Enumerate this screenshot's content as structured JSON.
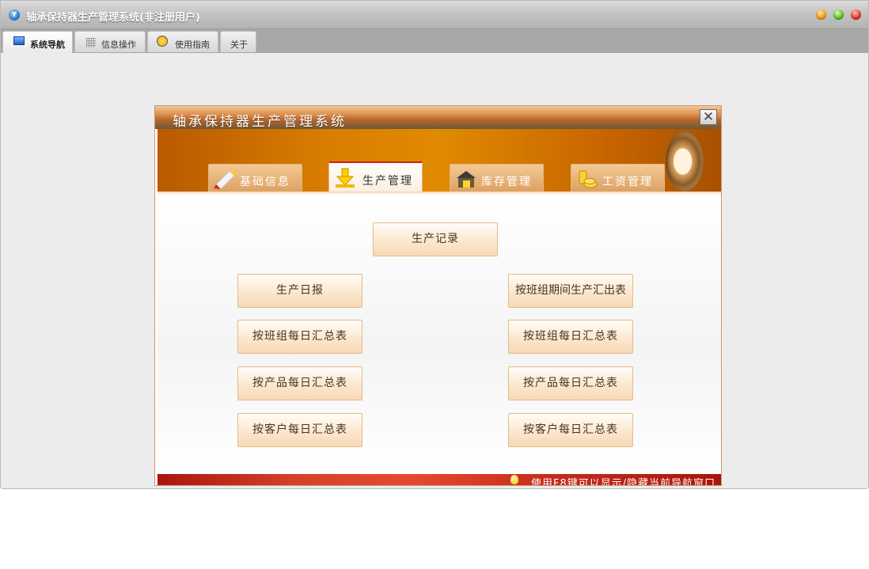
{
  "window": {
    "title": "轴承保持器生产管理系统(非注册用户)",
    "icon_text": "Y"
  },
  "main_tabs": [
    {
      "label": "系统导航",
      "active": true,
      "icon": "monitor-icon"
    },
    {
      "label": "信息操作",
      "active": false,
      "icon": "grid-icon"
    },
    {
      "label": "使用指南",
      "active": false,
      "icon": "guide-icon"
    },
    {
      "label": "关于",
      "active": false
    }
  ],
  "sub_window": {
    "title": "轴承保持器生产管理系统",
    "close_glyph": "✕"
  },
  "nav_tabs": [
    {
      "label": "基础信息",
      "active": false,
      "icon": "pencil-icon"
    },
    {
      "label": "生产管理",
      "active": true,
      "icon": "download-arrow-icon"
    },
    {
      "label": "库存管理",
      "active": false,
      "icon": "warehouse-icon"
    },
    {
      "label": "工资管理",
      "active": false,
      "icon": "coins-icon"
    }
  ],
  "buttons": {
    "production_record": "生产记录",
    "daily_report": "生产日报",
    "team_period_summary": "按班组期间生产汇出表",
    "team_daily_left": "按班组每日汇总表",
    "team_daily_right": "按班组每日汇总表",
    "product_daily_left": "按产品每日汇总表",
    "product_daily_right": "按产品每日汇总表",
    "customer_daily_left": "按客户每日汇总表",
    "customer_daily_right": "按客户每日汇总表"
  },
  "status_tip": "使用F8键可以显示/隐藏当前导航窗口",
  "colors": {
    "banner": "#d97d00",
    "active_tab_border": "#cf1e1e",
    "status_bar": "#d8402a"
  }
}
